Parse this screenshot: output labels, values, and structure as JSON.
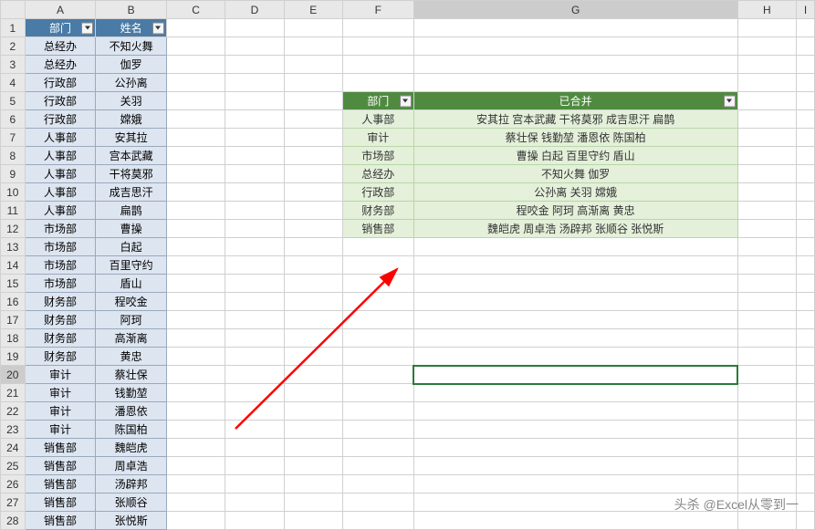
{
  "columns": [
    "A",
    "B",
    "C",
    "D",
    "E",
    "F",
    "G",
    "H",
    "I"
  ],
  "left_table": {
    "headers": {
      "dept": "部门",
      "name": "姓名"
    },
    "rows": [
      {
        "dept": "总经办",
        "name": "不知火舞"
      },
      {
        "dept": "总经办",
        "name": "伽罗"
      },
      {
        "dept": "行政部",
        "name": "公孙离"
      },
      {
        "dept": "行政部",
        "name": "关羽"
      },
      {
        "dept": "行政部",
        "name": "嫦娥"
      },
      {
        "dept": "人事部",
        "name": "安其拉"
      },
      {
        "dept": "人事部",
        "name": "宫本武藏"
      },
      {
        "dept": "人事部",
        "name": "干将莫邪"
      },
      {
        "dept": "人事部",
        "name": "成吉思汗"
      },
      {
        "dept": "人事部",
        "name": "扁鹊"
      },
      {
        "dept": "市场部",
        "name": "曹操"
      },
      {
        "dept": "市场部",
        "name": "白起"
      },
      {
        "dept": "市场部",
        "name": "百里守约"
      },
      {
        "dept": "市场部",
        "name": "盾山"
      },
      {
        "dept": "财务部",
        "name": "程咬金"
      },
      {
        "dept": "财务部",
        "name": "阿珂"
      },
      {
        "dept": "财务部",
        "name": "高渐离"
      },
      {
        "dept": "财务部",
        "name": "黄忠"
      },
      {
        "dept": "审计",
        "name": "蔡壮保"
      },
      {
        "dept": "审计",
        "name": "钱勤堃"
      },
      {
        "dept": "审计",
        "name": "潘恩依"
      },
      {
        "dept": "审计",
        "name": "陈国柏"
      },
      {
        "dept": "销售部",
        "name": "魏皑虎"
      },
      {
        "dept": "销售部",
        "name": "周卓浩"
      },
      {
        "dept": "销售部",
        "name": "汤辟邦"
      },
      {
        "dept": "销售部",
        "name": "张顺谷"
      },
      {
        "dept": "销售部",
        "name": "张悦斯"
      }
    ]
  },
  "right_table": {
    "headers": {
      "dept": "部门",
      "merged": "已合并"
    },
    "rows": [
      {
        "dept": "人事部",
        "merged": "安其拉 宫本武藏 干将莫邪 成吉思汗 扁鹊"
      },
      {
        "dept": "审计",
        "merged": "蔡壮保 钱勤堃 潘恩依 陈国柏"
      },
      {
        "dept": "市场部",
        "merged": "曹操 白起 百里守约 盾山"
      },
      {
        "dept": "总经办",
        "merged": "不知火舞 伽罗"
      },
      {
        "dept": "行政部",
        "merged": "公孙离 关羽 嫦娥"
      },
      {
        "dept": "财务部",
        "merged": "程咬金 阿珂 高渐离 黄忠"
      },
      {
        "dept": "销售部",
        "merged": "魏皑虎 周卓浩 汤辟邦 张顺谷 张悦斯"
      }
    ]
  },
  "watermark": "头杀 @Excel从零到一",
  "selected_row": 20
}
